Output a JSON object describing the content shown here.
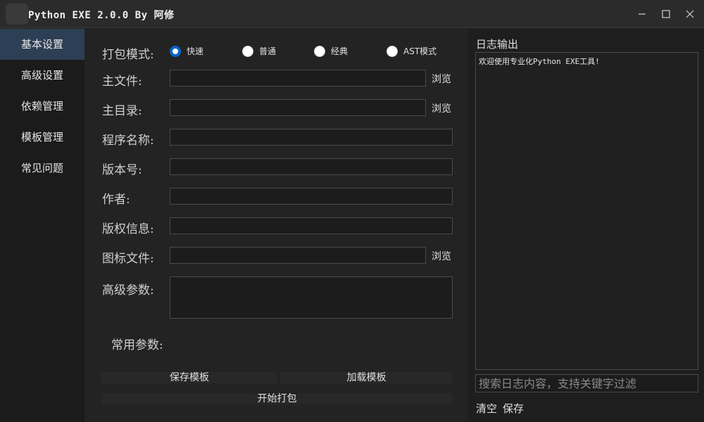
{
  "window": {
    "title": "Python EXE 2.0.0 By 阿修"
  },
  "sidebar": {
    "items": [
      {
        "label": "基本设置"
      },
      {
        "label": "高级设置"
      },
      {
        "label": "依赖管理"
      },
      {
        "label": "模板管理"
      },
      {
        "label": "常见问题"
      }
    ]
  },
  "form": {
    "mode_label": "打包模式:",
    "modes": [
      {
        "label": "快速",
        "checked": true
      },
      {
        "label": "普通",
        "checked": false
      },
      {
        "label": "经典",
        "checked": false
      },
      {
        "label": "AST模式",
        "checked": false
      }
    ],
    "main_file_label": "主文件:",
    "main_dir_label": "主目录:",
    "program_name_label": "程序名称:",
    "version_label": "版本号:",
    "author_label": "作者:",
    "copyright_label": "版权信息:",
    "icon_file_label": "图标文件:",
    "advanced_params_label": "高级参数:",
    "common_params_label": "常用参数:",
    "browse_label": "浏览",
    "main_file_value": "",
    "main_dir_value": "",
    "program_name_value": "",
    "version_value": "",
    "author_value": "",
    "copyright_value": "",
    "icon_file_value": "",
    "advanced_params_value": ""
  },
  "buttons": {
    "save_template": "保存模板",
    "load_template": "加载模板",
    "start_pack": "开始打包"
  },
  "log": {
    "title": "日志输出",
    "text": "欢迎使用专业化Python EXE工具!",
    "search_placeholder": "搜索日志内容，支持关键字过滤",
    "clear_label": "清空",
    "save_label": "保存"
  },
  "colors": {
    "accent": "#0a64c8",
    "sidebar_active": "#2d3f55",
    "background": "#1e1e1e"
  }
}
